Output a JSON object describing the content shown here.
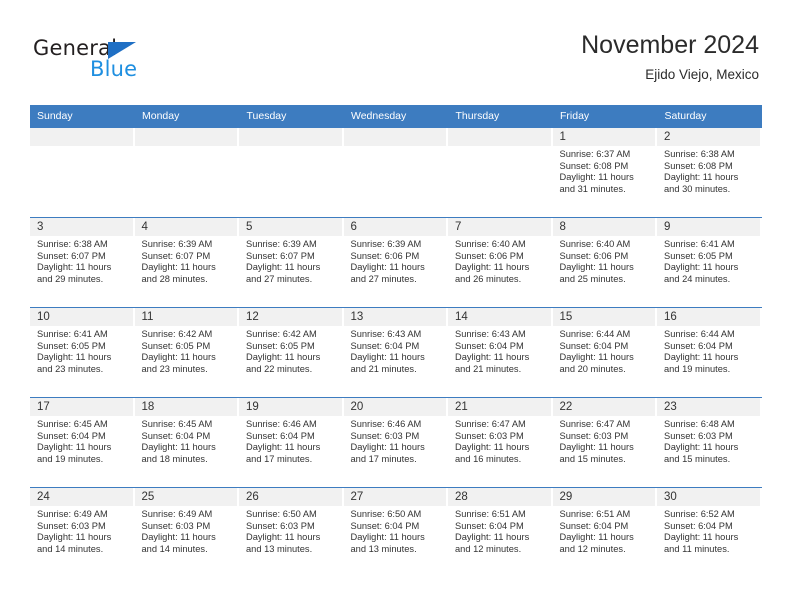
{
  "brand": {
    "name_part1": "General",
    "name_part2": "Blue",
    "accent_color": "#1f6fc4",
    "blue_text_color": "#1f8fe0"
  },
  "header": {
    "title": "November 2024",
    "subtitle": "Ejido Viejo, Mexico"
  },
  "theme": {
    "header_bg": "#3d7cc0",
    "header_text": "#ffffff",
    "daynum_band_bg": "#f1f1f1",
    "body_text": "#333333"
  },
  "weekdays": [
    "Sunday",
    "Monday",
    "Tuesday",
    "Wednesday",
    "Thursday",
    "Friday",
    "Saturday"
  ],
  "labels": {
    "sunrise_prefix": "Sunrise:",
    "sunset_prefix": "Sunset:",
    "daylight_prefix": "Daylight:"
  },
  "weeks": [
    [
      {
        "empty": true
      },
      {
        "empty": true
      },
      {
        "empty": true
      },
      {
        "empty": true
      },
      {
        "empty": true
      },
      {
        "day": "1",
        "sunrise": "Sunrise: 6:37 AM",
        "sunset": "Sunset: 6:08 PM",
        "daylight_line1": "Daylight: 11 hours",
        "daylight_line2": "and 31 minutes."
      },
      {
        "day": "2",
        "sunrise": "Sunrise: 6:38 AM",
        "sunset": "Sunset: 6:08 PM",
        "daylight_line1": "Daylight: 11 hours",
        "daylight_line2": "and 30 minutes."
      }
    ],
    [
      {
        "day": "3",
        "sunrise": "Sunrise: 6:38 AM",
        "sunset": "Sunset: 6:07 PM",
        "daylight_line1": "Daylight: 11 hours",
        "daylight_line2": "and 29 minutes."
      },
      {
        "day": "4",
        "sunrise": "Sunrise: 6:39 AM",
        "sunset": "Sunset: 6:07 PM",
        "daylight_line1": "Daylight: 11 hours",
        "daylight_line2": "and 28 minutes."
      },
      {
        "day": "5",
        "sunrise": "Sunrise: 6:39 AM",
        "sunset": "Sunset: 6:07 PM",
        "daylight_line1": "Daylight: 11 hours",
        "daylight_line2": "and 27 minutes."
      },
      {
        "day": "6",
        "sunrise": "Sunrise: 6:39 AM",
        "sunset": "Sunset: 6:06 PM",
        "daylight_line1": "Daylight: 11 hours",
        "daylight_line2": "and 27 minutes."
      },
      {
        "day": "7",
        "sunrise": "Sunrise: 6:40 AM",
        "sunset": "Sunset: 6:06 PM",
        "daylight_line1": "Daylight: 11 hours",
        "daylight_line2": "and 26 minutes."
      },
      {
        "day": "8",
        "sunrise": "Sunrise: 6:40 AM",
        "sunset": "Sunset: 6:06 PM",
        "daylight_line1": "Daylight: 11 hours",
        "daylight_line2": "and 25 minutes."
      },
      {
        "day": "9",
        "sunrise": "Sunrise: 6:41 AM",
        "sunset": "Sunset: 6:05 PM",
        "daylight_line1": "Daylight: 11 hours",
        "daylight_line2": "and 24 minutes."
      }
    ],
    [
      {
        "day": "10",
        "sunrise": "Sunrise: 6:41 AM",
        "sunset": "Sunset: 6:05 PM",
        "daylight_line1": "Daylight: 11 hours",
        "daylight_line2": "and 23 minutes."
      },
      {
        "day": "11",
        "sunrise": "Sunrise: 6:42 AM",
        "sunset": "Sunset: 6:05 PM",
        "daylight_line1": "Daylight: 11 hours",
        "daylight_line2": "and 23 minutes."
      },
      {
        "day": "12",
        "sunrise": "Sunrise: 6:42 AM",
        "sunset": "Sunset: 6:05 PM",
        "daylight_line1": "Daylight: 11 hours",
        "daylight_line2": "and 22 minutes."
      },
      {
        "day": "13",
        "sunrise": "Sunrise: 6:43 AM",
        "sunset": "Sunset: 6:04 PM",
        "daylight_line1": "Daylight: 11 hours",
        "daylight_line2": "and 21 minutes."
      },
      {
        "day": "14",
        "sunrise": "Sunrise: 6:43 AM",
        "sunset": "Sunset: 6:04 PM",
        "daylight_line1": "Daylight: 11 hours",
        "daylight_line2": "and 21 minutes."
      },
      {
        "day": "15",
        "sunrise": "Sunrise: 6:44 AM",
        "sunset": "Sunset: 6:04 PM",
        "daylight_line1": "Daylight: 11 hours",
        "daylight_line2": "and 20 minutes."
      },
      {
        "day": "16",
        "sunrise": "Sunrise: 6:44 AM",
        "sunset": "Sunset: 6:04 PM",
        "daylight_line1": "Daylight: 11 hours",
        "daylight_line2": "and 19 minutes."
      }
    ],
    [
      {
        "day": "17",
        "sunrise": "Sunrise: 6:45 AM",
        "sunset": "Sunset: 6:04 PM",
        "daylight_line1": "Daylight: 11 hours",
        "daylight_line2": "and 19 minutes."
      },
      {
        "day": "18",
        "sunrise": "Sunrise: 6:45 AM",
        "sunset": "Sunset: 6:04 PM",
        "daylight_line1": "Daylight: 11 hours",
        "daylight_line2": "and 18 minutes."
      },
      {
        "day": "19",
        "sunrise": "Sunrise: 6:46 AM",
        "sunset": "Sunset: 6:04 PM",
        "daylight_line1": "Daylight: 11 hours",
        "daylight_line2": "and 17 minutes."
      },
      {
        "day": "20",
        "sunrise": "Sunrise: 6:46 AM",
        "sunset": "Sunset: 6:03 PM",
        "daylight_line1": "Daylight: 11 hours",
        "daylight_line2": "and 17 minutes."
      },
      {
        "day": "21",
        "sunrise": "Sunrise: 6:47 AM",
        "sunset": "Sunset: 6:03 PM",
        "daylight_line1": "Daylight: 11 hours",
        "daylight_line2": "and 16 minutes."
      },
      {
        "day": "22",
        "sunrise": "Sunrise: 6:47 AM",
        "sunset": "Sunset: 6:03 PM",
        "daylight_line1": "Daylight: 11 hours",
        "daylight_line2": "and 15 minutes."
      },
      {
        "day": "23",
        "sunrise": "Sunrise: 6:48 AM",
        "sunset": "Sunset: 6:03 PM",
        "daylight_line1": "Daylight: 11 hours",
        "daylight_line2": "and 15 minutes."
      }
    ],
    [
      {
        "day": "24",
        "sunrise": "Sunrise: 6:49 AM",
        "sunset": "Sunset: 6:03 PM",
        "daylight_line1": "Daylight: 11 hours",
        "daylight_line2": "and 14 minutes."
      },
      {
        "day": "25",
        "sunrise": "Sunrise: 6:49 AM",
        "sunset": "Sunset: 6:03 PM",
        "daylight_line1": "Daylight: 11 hours",
        "daylight_line2": "and 14 minutes."
      },
      {
        "day": "26",
        "sunrise": "Sunrise: 6:50 AM",
        "sunset": "Sunset: 6:03 PM",
        "daylight_line1": "Daylight: 11 hours",
        "daylight_line2": "and 13 minutes."
      },
      {
        "day": "27",
        "sunrise": "Sunrise: 6:50 AM",
        "sunset": "Sunset: 6:04 PM",
        "daylight_line1": "Daylight: 11 hours",
        "daylight_line2": "and 13 minutes."
      },
      {
        "day": "28",
        "sunrise": "Sunrise: 6:51 AM",
        "sunset": "Sunset: 6:04 PM",
        "daylight_line1": "Daylight: 11 hours",
        "daylight_line2": "and 12 minutes."
      },
      {
        "day": "29",
        "sunrise": "Sunrise: 6:51 AM",
        "sunset": "Sunset: 6:04 PM",
        "daylight_line1": "Daylight: 11 hours",
        "daylight_line2": "and 12 minutes."
      },
      {
        "day": "30",
        "sunrise": "Sunrise: 6:52 AM",
        "sunset": "Sunset: 6:04 PM",
        "daylight_line1": "Daylight: 11 hours",
        "daylight_line2": "and 11 minutes."
      }
    ]
  ]
}
